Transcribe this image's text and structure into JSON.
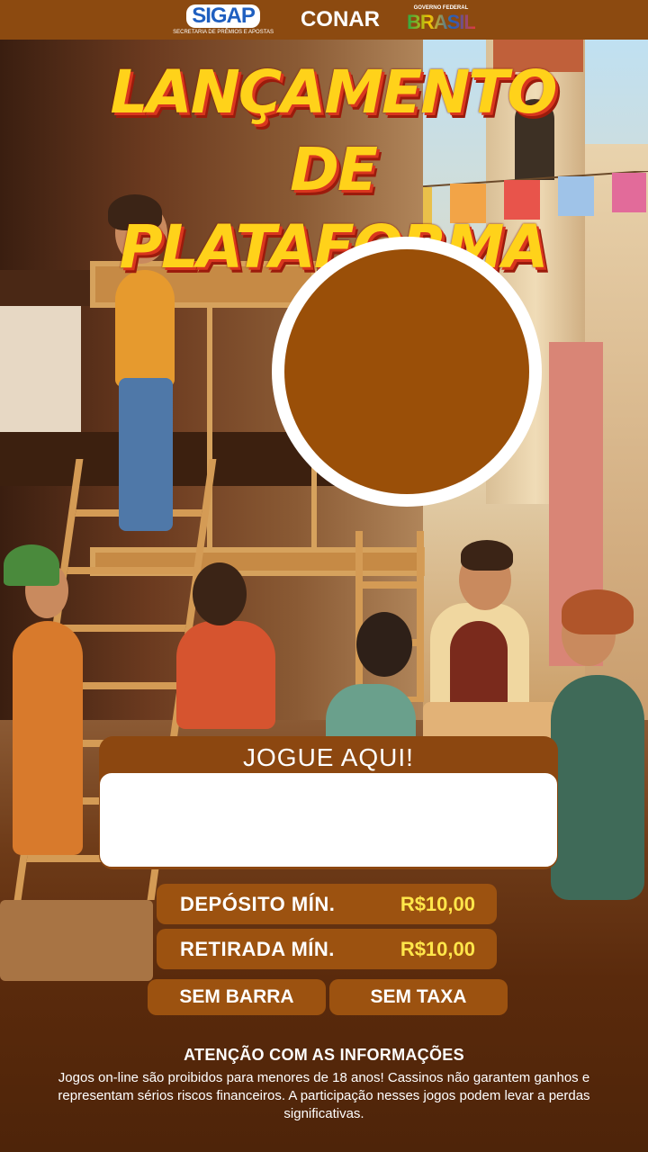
{
  "header": {
    "logos": [
      {
        "name": "SIGAP",
        "subtitle": "SECRETARIA DE PRÊMIOS E APOSTAS"
      },
      {
        "name": "CONAR"
      },
      {
        "name": "BRASIL",
        "subtitle": "GOVERNO FEDERAL"
      }
    ]
  },
  "hero": {
    "title_line1": "LANÇAMENTO DE",
    "title_line2": "PLATAFORMA"
  },
  "play": {
    "label": "JOGUE AQUI!"
  },
  "info": {
    "deposit_label": "DEPÓSITO MÍN.",
    "deposit_value": "R$10,00",
    "withdraw_label": "RETIRADA MÍN.",
    "withdraw_value": "R$10,00",
    "no_bar_label": "SEM BARRA",
    "no_fee_label": "SEM TAXA"
  },
  "footer": {
    "title": "ATENÇÃO COM AS INFORMAÇÕES",
    "text": "Jogos on-line são proibidos para menores de 18 anos! Cassinos não garantem ganhos e representam sérios riscos financeiros. A participação nesses jogos podem levar a perdas significativas."
  },
  "colors": {
    "brand_brown": "#8c4710",
    "accent_yellow": "#ffe64a",
    "title_yellow": "#ffd21a",
    "title_red": "#d9361e"
  }
}
